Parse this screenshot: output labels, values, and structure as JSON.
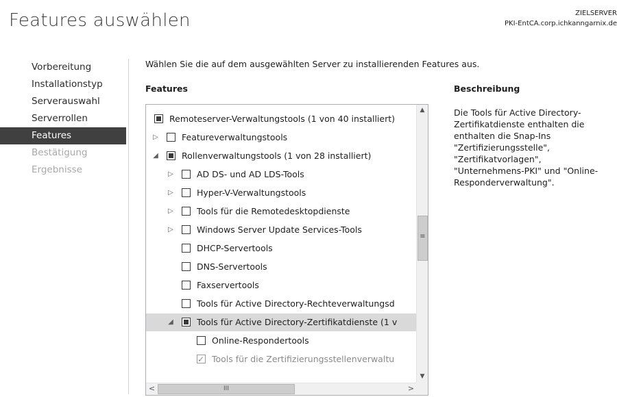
{
  "page": {
    "title": "Features auswählen",
    "target_label": "ZIELSERVER",
    "target_server": "PKI-EntCA.corp.ichkanngarnix.de"
  },
  "nav": {
    "items": [
      {
        "label": "Vorbereitung",
        "state": "normal"
      },
      {
        "label": "Installationstyp",
        "state": "normal"
      },
      {
        "label": "Serverauswahl",
        "state": "normal"
      },
      {
        "label": "Serverrollen",
        "state": "normal"
      },
      {
        "label": "Features",
        "state": "selected"
      },
      {
        "label": "Bestätigung",
        "state": "disabled"
      },
      {
        "label": "Ergebnisse",
        "state": "disabled"
      }
    ]
  },
  "main": {
    "instruction": "Wählen Sie die auf dem ausgewählten Server zu installierenden Features aus.",
    "features_heading": "Features",
    "description_heading": "Beschreibung",
    "description_text": "Die Tools für Active Directory-Zertifikatdienste enthalten die enthalten die Snap-Ins \"Zertifizierungsstelle\", \"Zertifikatvorlagen\", \"Unternehmens-PKI\" und \"Online-Responderverwaltung\"."
  },
  "tree": {
    "items": [
      {
        "label": "Remoteserver-Verwaltungstools (1 von 40 installiert)",
        "expander": "none",
        "check": "partial"
      },
      {
        "label": "Featureverwaltungstools",
        "expander": "collapsed",
        "check": "unchecked"
      },
      {
        "label": "Rollenverwaltungstools (1 von 28 installiert)",
        "expander": "expanded",
        "check": "partial"
      },
      {
        "label": "AD DS- und AD LDS-Tools",
        "expander": "collapsed",
        "check": "unchecked"
      },
      {
        "label": "Hyper-V-Verwaltungstools",
        "expander": "collapsed",
        "check": "unchecked"
      },
      {
        "label": "Tools für die Remotedesktopdienste",
        "expander": "collapsed",
        "check": "unchecked"
      },
      {
        "label": "Windows Server Update Services-Tools",
        "expander": "collapsed",
        "check": "unchecked"
      },
      {
        "label": "DHCP-Servertools",
        "expander": "none",
        "check": "unchecked"
      },
      {
        "label": "DNS-Servertools",
        "expander": "none",
        "check": "unchecked"
      },
      {
        "label": "Faxservertools",
        "expander": "none",
        "check": "unchecked"
      },
      {
        "label": "Tools für Active Directory-Rechteverwaltungsd",
        "expander": "none",
        "check": "unchecked"
      },
      {
        "label": "Tools für Active Directory-Zertifikatdienste (1 v",
        "expander": "expanded",
        "check": "partial",
        "highlighted": true
      },
      {
        "label": "Online-Respondertools",
        "expander": "none",
        "check": "unchecked"
      },
      {
        "label": "Tools für die Zertifizierungsstellenverwaltu",
        "expander": "none",
        "check": "checked",
        "disabled": true
      }
    ]
  },
  "scrollbars": {
    "up": "▲",
    "down": "▼",
    "left": "<",
    "right": ">",
    "v_grip": "≡",
    "h_grip": "III"
  }
}
